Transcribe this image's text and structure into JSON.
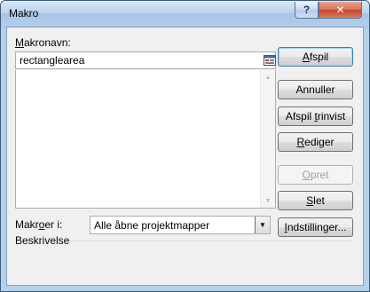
{
  "window": {
    "title": "Makro",
    "help_label": "?",
    "close_label": "✕"
  },
  "form": {
    "macro_name_label_key": "M",
    "macro_name_label_rest": "akronavn:",
    "macro_name_value": "rectanglearea",
    "macros_in_label_pre": "Makr",
    "macros_in_label_key": "o",
    "macros_in_label_post": "er i:",
    "macros_in_value": "Alle åbne projektmapper",
    "description_label": "Beskrivelse"
  },
  "buttons": {
    "run_key": "A",
    "run_rest": "fspil",
    "cancel": "Annuller",
    "step_pre": "Afspil ",
    "step_key": "t",
    "step_post": "rinvist",
    "edit_key": "R",
    "edit_rest": "ediger",
    "create_key": "O",
    "create_rest": "pret",
    "delete_key": "S",
    "delete_rest": "let",
    "options_key": "I",
    "options_rest": "ndstillinger..."
  },
  "state": {
    "create_enabled": false
  },
  "icons": {
    "reference": "collapse-dialog-icon",
    "scroll_up": "scroll-up-arrow-icon",
    "scroll_down": "scroll-down-arrow-icon",
    "dropdown": "chevron-down-icon"
  }
}
